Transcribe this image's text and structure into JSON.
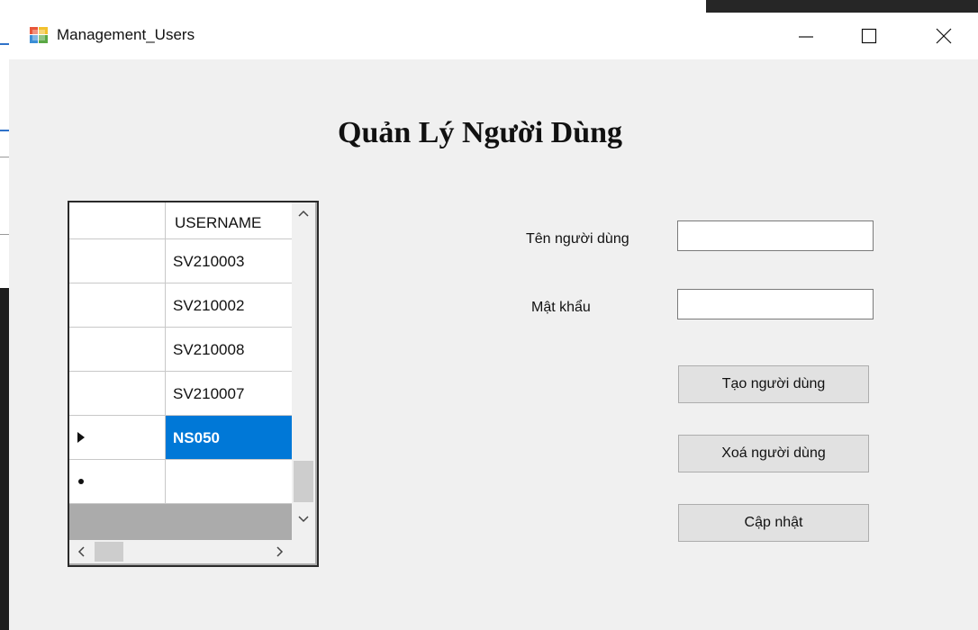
{
  "window": {
    "title": "Management_Users"
  },
  "heading": "Quản Lý Người Dùng",
  "grid": {
    "column_header": "USERNAME",
    "rows": [
      {
        "username": "SV210003",
        "selected": false
      },
      {
        "username": "SV210002",
        "selected": false
      },
      {
        "username": "SV210008",
        "selected": false
      },
      {
        "username": "SV210007",
        "selected": false
      },
      {
        "username": "NS050",
        "selected": true
      }
    ]
  },
  "form": {
    "name_label": "Tên người dùng",
    "password_label": "Mật khẩu",
    "name_value": "",
    "password_value": ""
  },
  "buttons": {
    "create": "Tạo người dùng",
    "delete": "Xoá người dùng",
    "update": "Cập nhật"
  },
  "colors": {
    "selection": "#0078d7",
    "window_bg": "#f0f0f0"
  }
}
